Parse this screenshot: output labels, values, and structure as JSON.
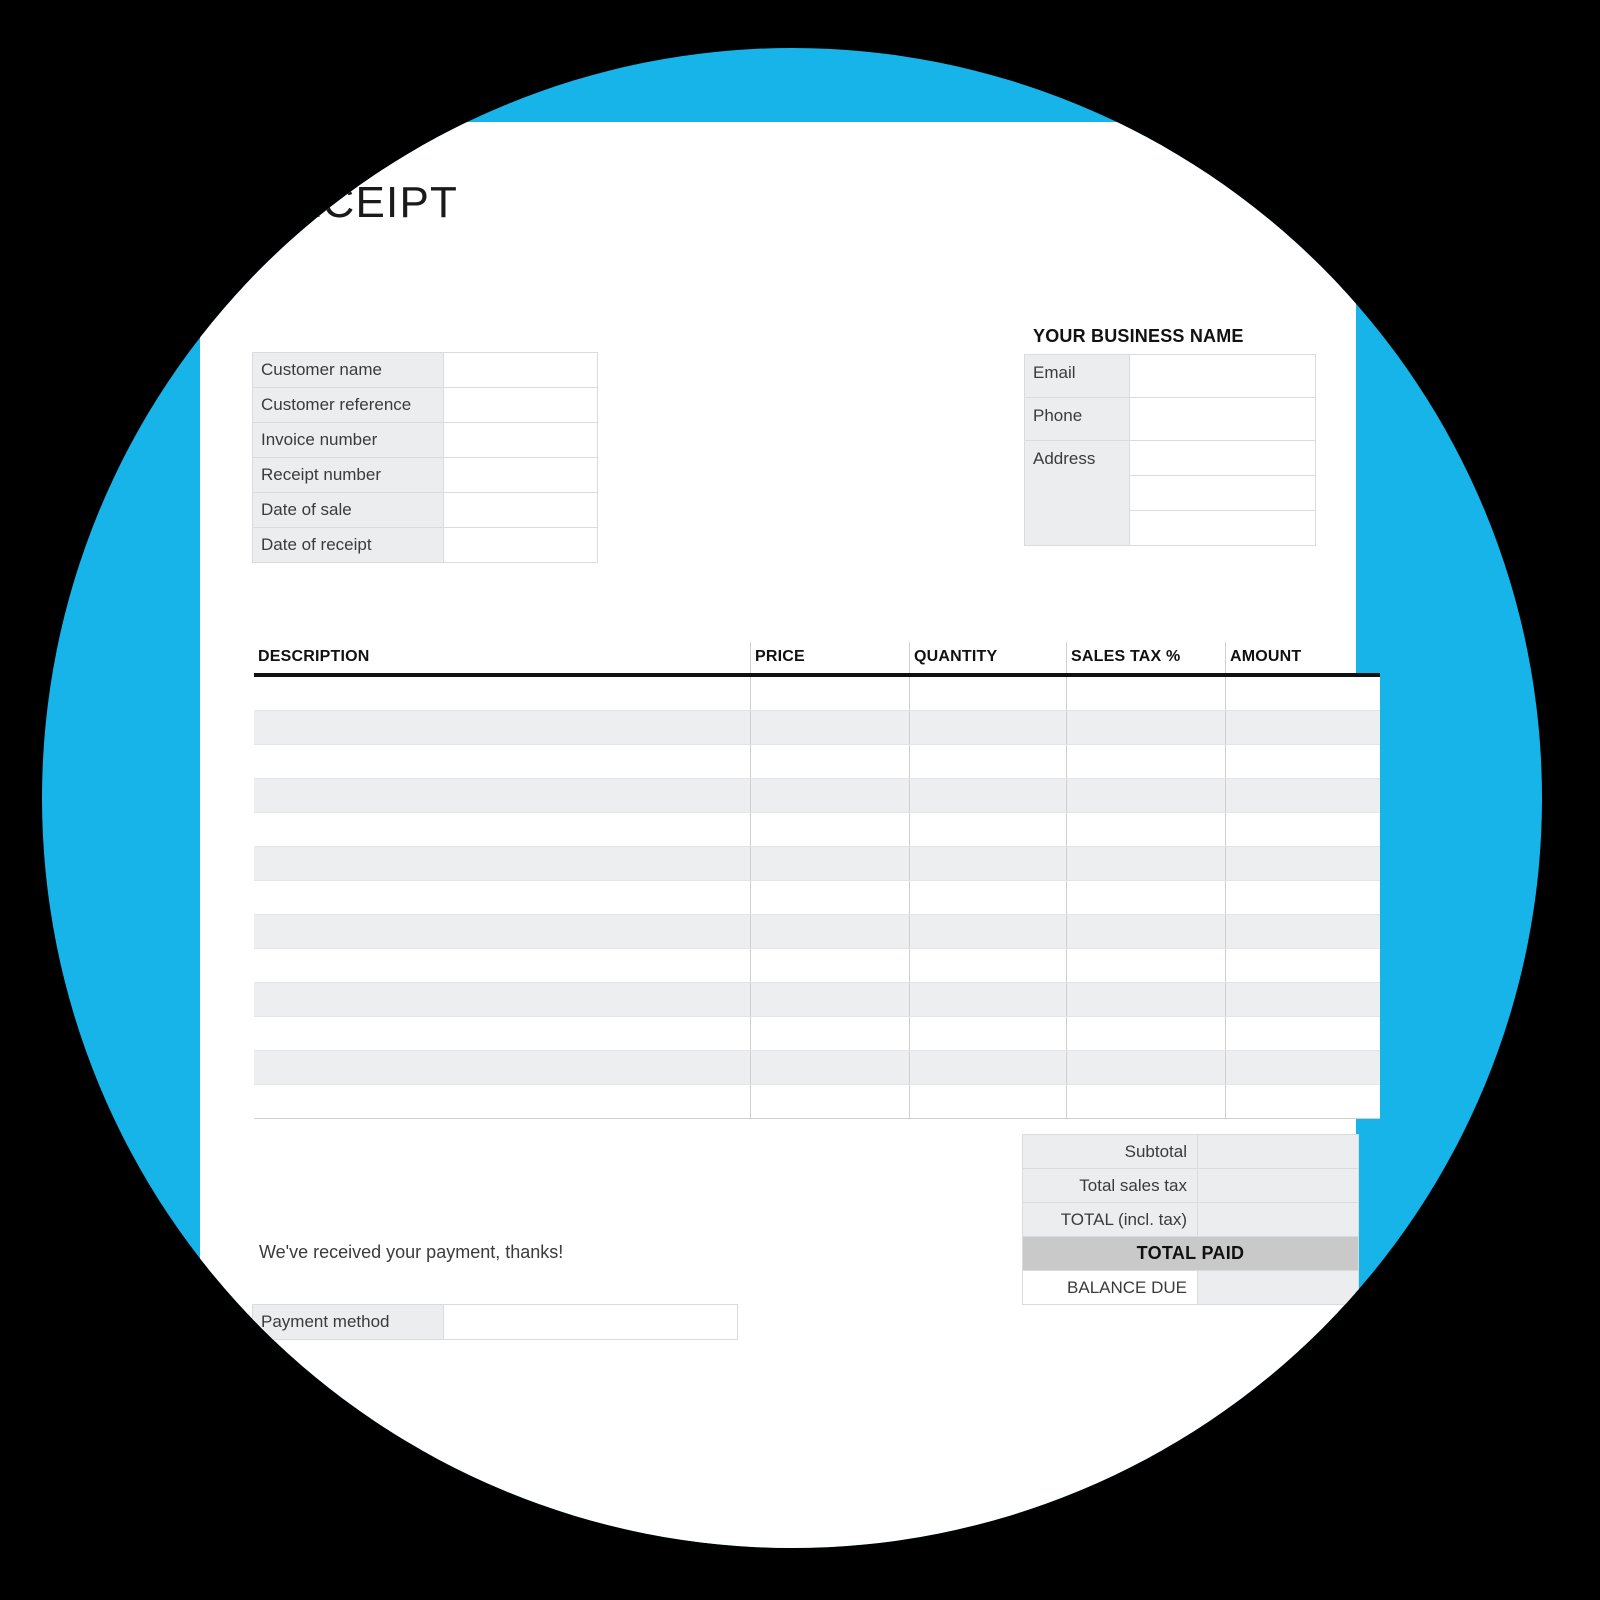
{
  "theme": {
    "background": "#000000",
    "accent_blue": "#17B4E9",
    "page_background": "#FFFFFF",
    "field_label_gray": "#ECEDEE",
    "total_paid_gray": "#C9C9C9"
  },
  "document": {
    "title": "RECEIPT"
  },
  "customer": {
    "fields": [
      {
        "label": "Customer name",
        "value": ""
      },
      {
        "label": "Customer reference",
        "value": ""
      },
      {
        "label": "Invoice number",
        "value": ""
      },
      {
        "label": "Receipt number",
        "value": ""
      },
      {
        "label": "Date of sale",
        "value": ""
      },
      {
        "label": "Date of receipt",
        "value": ""
      }
    ]
  },
  "business": {
    "heading": "YOUR BUSINESS NAME",
    "fields": [
      {
        "label": "Email",
        "value": ""
      },
      {
        "label": "Phone",
        "value": ""
      },
      {
        "label": "Address",
        "value": ""
      }
    ],
    "address_extra_lines": [
      "",
      ""
    ]
  },
  "items": {
    "columns": [
      "DESCRIPTION",
      "PRICE",
      "QUANTITY",
      "SALES TAX %",
      "AMOUNT"
    ],
    "rows": [
      {
        "description": "",
        "price": "",
        "quantity": "",
        "sales_tax": "",
        "amount": ""
      },
      {
        "description": "",
        "price": "",
        "quantity": "",
        "sales_tax": "",
        "amount": ""
      },
      {
        "description": "",
        "price": "",
        "quantity": "",
        "sales_tax": "",
        "amount": ""
      },
      {
        "description": "",
        "price": "",
        "quantity": "",
        "sales_tax": "",
        "amount": ""
      },
      {
        "description": "",
        "price": "",
        "quantity": "",
        "sales_tax": "",
        "amount": ""
      },
      {
        "description": "",
        "price": "",
        "quantity": "",
        "sales_tax": "",
        "amount": ""
      },
      {
        "description": "",
        "price": "",
        "quantity": "",
        "sales_tax": "",
        "amount": ""
      },
      {
        "description": "",
        "price": "",
        "quantity": "",
        "sales_tax": "",
        "amount": ""
      },
      {
        "description": "",
        "price": "",
        "quantity": "",
        "sales_tax": "",
        "amount": ""
      },
      {
        "description": "",
        "price": "",
        "quantity": "",
        "sales_tax": "",
        "amount": ""
      },
      {
        "description": "",
        "price": "",
        "quantity": "",
        "sales_tax": "",
        "amount": ""
      },
      {
        "description": "",
        "price": "",
        "quantity": "",
        "sales_tax": "",
        "amount": ""
      },
      {
        "description": "",
        "price": "",
        "quantity": "",
        "sales_tax": "",
        "amount": ""
      }
    ]
  },
  "totals": {
    "rows": [
      {
        "label": "Subtotal",
        "value": ""
      },
      {
        "label": "Total sales tax",
        "value": ""
      },
      {
        "label": "TOTAL (incl. tax)",
        "value": ""
      }
    ],
    "total_paid_label": "TOTAL PAID",
    "total_paid_value": "",
    "balance_due_label": "BALANCE DUE",
    "balance_due_value": ""
  },
  "footer": {
    "thanks_note": "We've received your payment, thanks!",
    "payment_method_label": "Payment method",
    "payment_method_value": ""
  }
}
